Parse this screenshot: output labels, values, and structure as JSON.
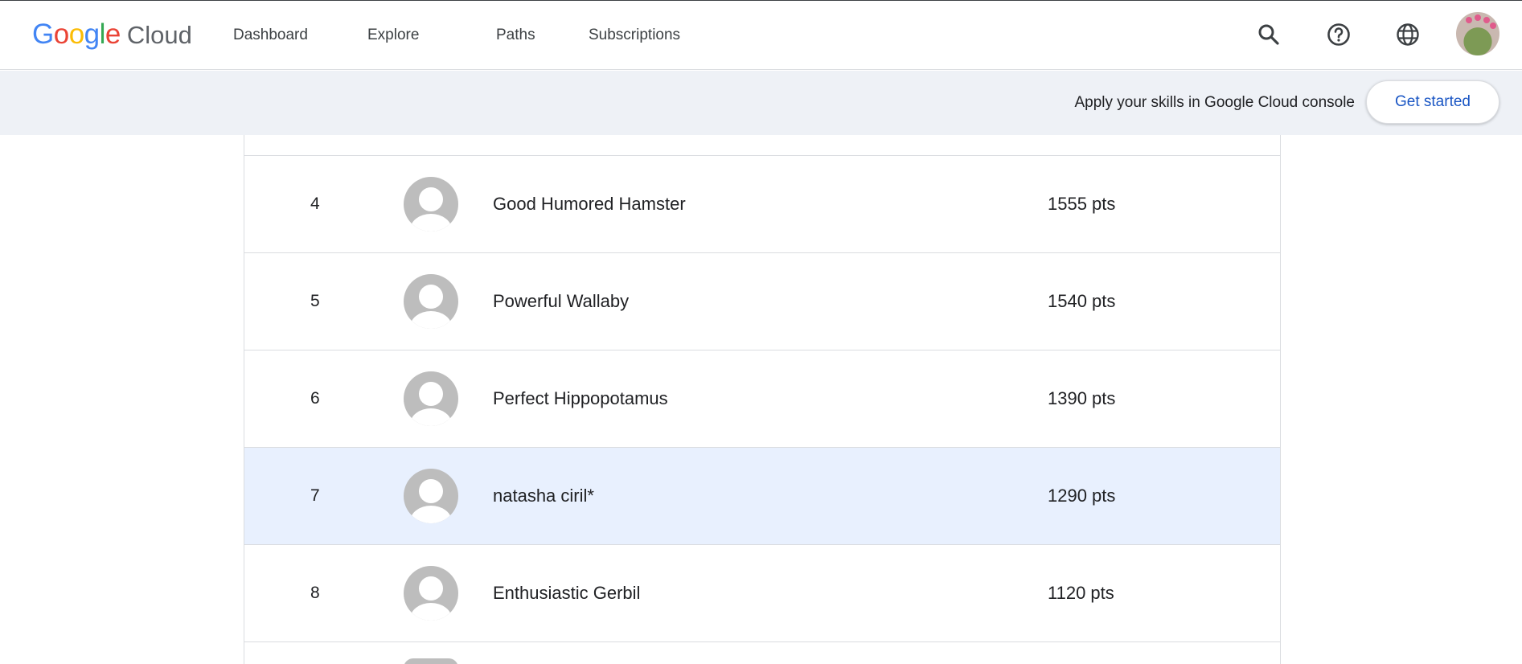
{
  "header": {
    "logo": {
      "google_letters": [
        {
          "ch": "G",
          "color": "#4285F4"
        },
        {
          "ch": "o",
          "color": "#EA4335"
        },
        {
          "ch": "o",
          "color": "#FBBC05"
        },
        {
          "ch": "g",
          "color": "#4285F4"
        },
        {
          "ch": "l",
          "color": "#34A853"
        },
        {
          "ch": "e",
          "color": "#EA4335"
        }
      ],
      "product": "Cloud"
    },
    "nav": [
      "Dashboard",
      "Explore",
      "Paths",
      "Subscriptions"
    ],
    "icons": [
      "search-icon",
      "help-icon",
      "language-globe-icon",
      "account-avatar"
    ]
  },
  "banner": {
    "text": "Apply your skills in Google Cloud console",
    "button_label": "Get started"
  },
  "leaderboard": {
    "rows": [
      {
        "rank": "4",
        "name": "Good Humored Hamster",
        "points": "1555 pts",
        "highlighted": false
      },
      {
        "rank": "5",
        "name": "Powerful Wallaby",
        "points": "1540 pts",
        "highlighted": false
      },
      {
        "rank": "6",
        "name": "Perfect Hippopotamus",
        "points": "1390 pts",
        "highlighted": false
      },
      {
        "rank": "7",
        "name": "natasha ciril*",
        "points": "1290 pts",
        "highlighted": true
      },
      {
        "rank": "8",
        "name": "Enthusiastic Gerbil",
        "points": "1120 pts",
        "highlighted": false
      }
    ]
  },
  "colors": {
    "highlight_row": "#e8f0fe",
    "banner_bg": "#eef1f6",
    "link_blue": "#1a56c4"
  }
}
